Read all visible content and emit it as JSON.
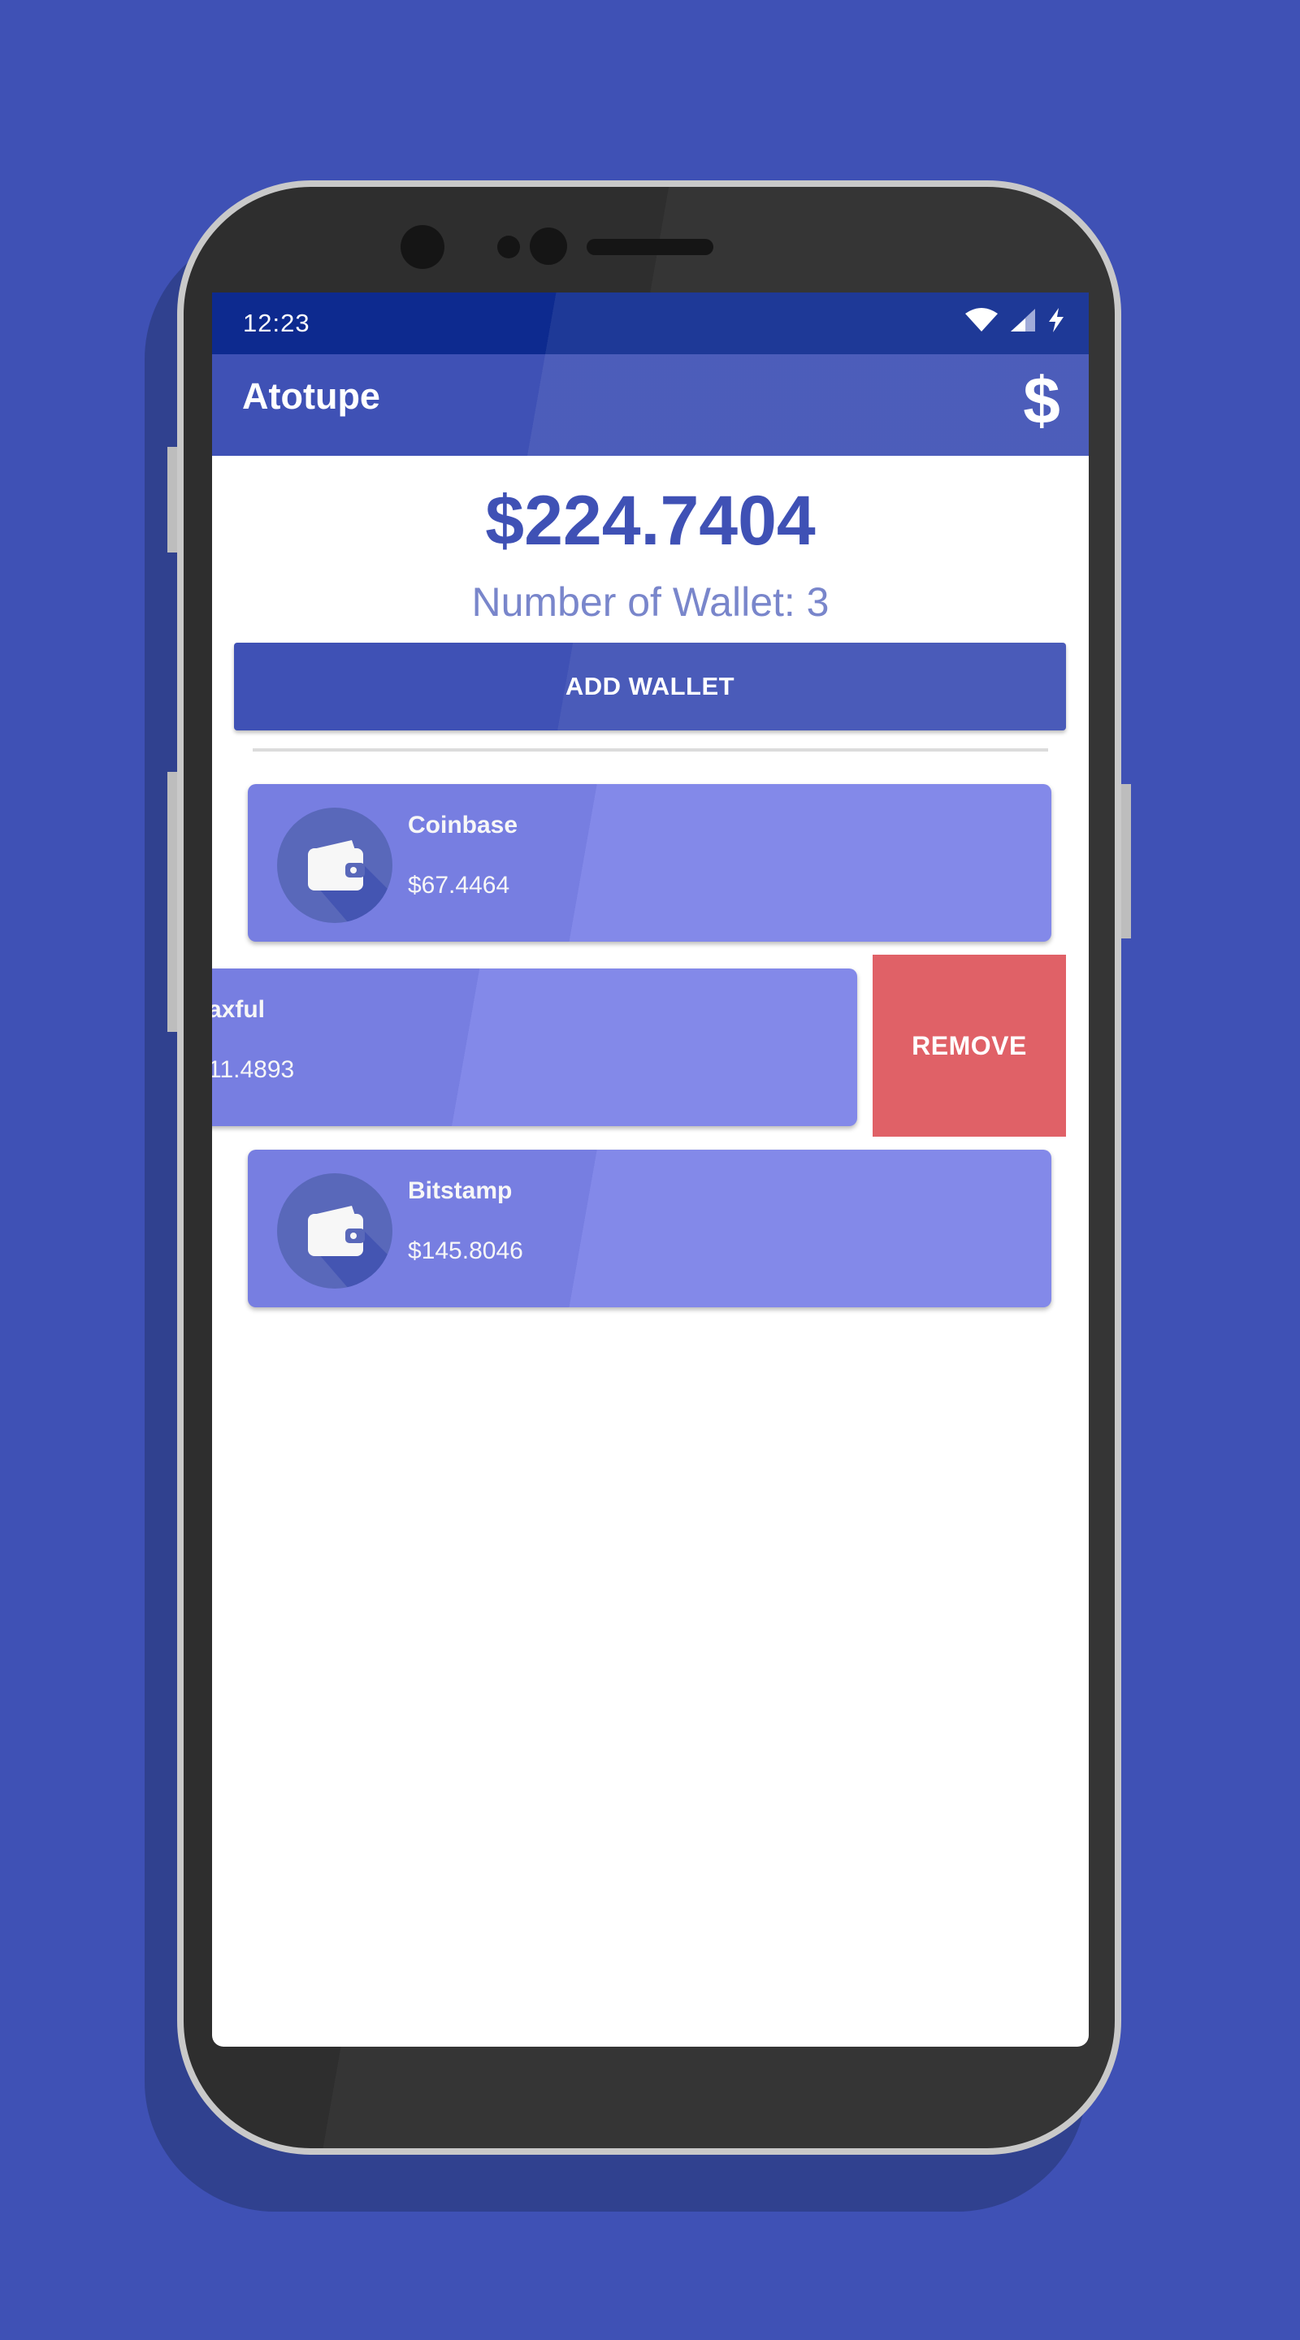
{
  "status_bar": {
    "time": "12:23"
  },
  "app_bar": {
    "title": "Atotupe",
    "action_symbol": "$"
  },
  "summary": {
    "total_balance": "$224.7404",
    "wallet_count_text": "Number of Wallet: 3"
  },
  "actions": {
    "add_wallet_label": "ADD WALLET"
  },
  "wallets": [
    {
      "name": "Coinbase",
      "amount": "$67.4464",
      "icon": "wallet-icon"
    },
    {
      "name": "axful",
      "amount": "11.4893",
      "icon": "wallet-icon"
    },
    {
      "name": "Bitstamp",
      "amount": "$145.8046",
      "icon": "wallet-icon"
    }
  ],
  "swipe_action": {
    "remove_label": "REMOVE"
  },
  "colors": {
    "primary": "#3f51b5",
    "primary_dark": "#0d2a8f",
    "card": "#7b82e8",
    "remove": "#e06167",
    "accent_text": "#7986cb"
  }
}
